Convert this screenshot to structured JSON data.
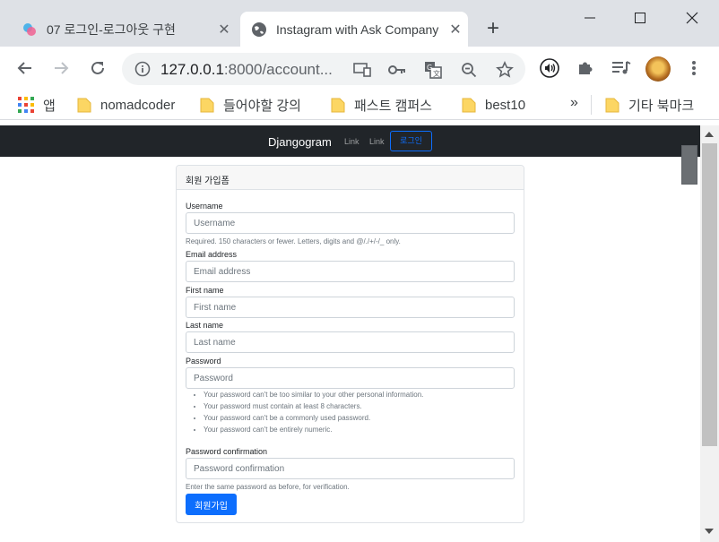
{
  "browser": {
    "tabs": [
      {
        "title": "07 로그인-로그아웃 구현",
        "active": false
      },
      {
        "title": "Instagram with Ask Company",
        "active": true
      }
    ],
    "url_host": "127.0.0.1",
    "url_rest": ":8000/account...",
    "bookmarks": [
      {
        "label": "앱"
      },
      {
        "label": "nomadcoder"
      },
      {
        "label": "들어야할 강의"
      },
      {
        "label": "패스트 캠퍼스"
      },
      {
        "label": "best10"
      }
    ],
    "bookmarks_more": "»",
    "other_bookmarks": "기타 북마크"
  },
  "site": {
    "brand": "Djangogram",
    "nav_links": [
      "Link",
      "Link"
    ],
    "login_button": "로그인"
  },
  "form": {
    "header": "회원 가입폼",
    "username": {
      "label": "Username",
      "placeholder": "Username",
      "help": "Required. 150 characters or fewer. Letters, digits and @/./+/-/_ only."
    },
    "email": {
      "label": "Email address",
      "placeholder": "Email address"
    },
    "first_name": {
      "label": "First name",
      "placeholder": "First name"
    },
    "last_name": {
      "label": "Last name",
      "placeholder": "Last name"
    },
    "password": {
      "label": "Password",
      "placeholder": "Password",
      "rules": [
        "Your password can't be too similar to your other personal information.",
        "Your password must contain at least 8 characters.",
        "Your password can't be a commonly used password.",
        "Your password can't be entirely numeric."
      ]
    },
    "password_confirm": {
      "label": "Password confirmation",
      "placeholder": "Password confirmation",
      "help": "Enter the same password as before, for verification."
    },
    "submit_label": "회원가입"
  },
  "colors": {
    "primary": "#0d6efd",
    "navbar": "#212529",
    "tab_strip": "#dee1e6"
  }
}
